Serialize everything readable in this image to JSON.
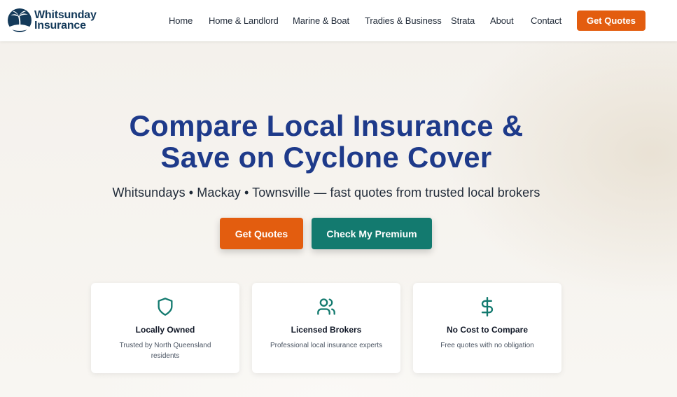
{
  "brand": {
    "name_line1": "Whitsunday",
    "name_line2": "Insurance",
    "logo_icon": "palm-tree-icon",
    "color": "#143a5a"
  },
  "nav": {
    "items": [
      {
        "label": "Home"
      },
      {
        "label": "Home & Landlord"
      },
      {
        "label": "Marine & Boat"
      },
      {
        "label": "Tradies & Business"
      },
      {
        "label": "Strata"
      },
      {
        "label": "About"
      },
      {
        "label": "Contact"
      }
    ],
    "cta_label": "Get Quotes"
  },
  "hero": {
    "title_line1": "Compare Local Insurance &",
    "title_line2": "Save on Cyclone Cover",
    "subtitle": "Whitsundays • Mackay • Townsville — fast quotes from trusted local brokers",
    "primary_button": "Get Quotes",
    "secondary_button": "Check My Premium"
  },
  "features": [
    {
      "icon": "shield-icon",
      "title": "Locally Owned",
      "description": "Trusted by North Queensland residents"
    },
    {
      "icon": "users-icon",
      "title": "Licensed Brokers",
      "description": "Professional local insurance experts"
    },
    {
      "icon": "dollar-icon",
      "title": "No Cost to Compare",
      "description": "Free quotes with no obligation"
    }
  ],
  "colors": {
    "accent_orange": "#e35d0f",
    "accent_teal": "#137a6f",
    "heading_blue": "#1e3a8a",
    "background": "#f6f3ee"
  }
}
